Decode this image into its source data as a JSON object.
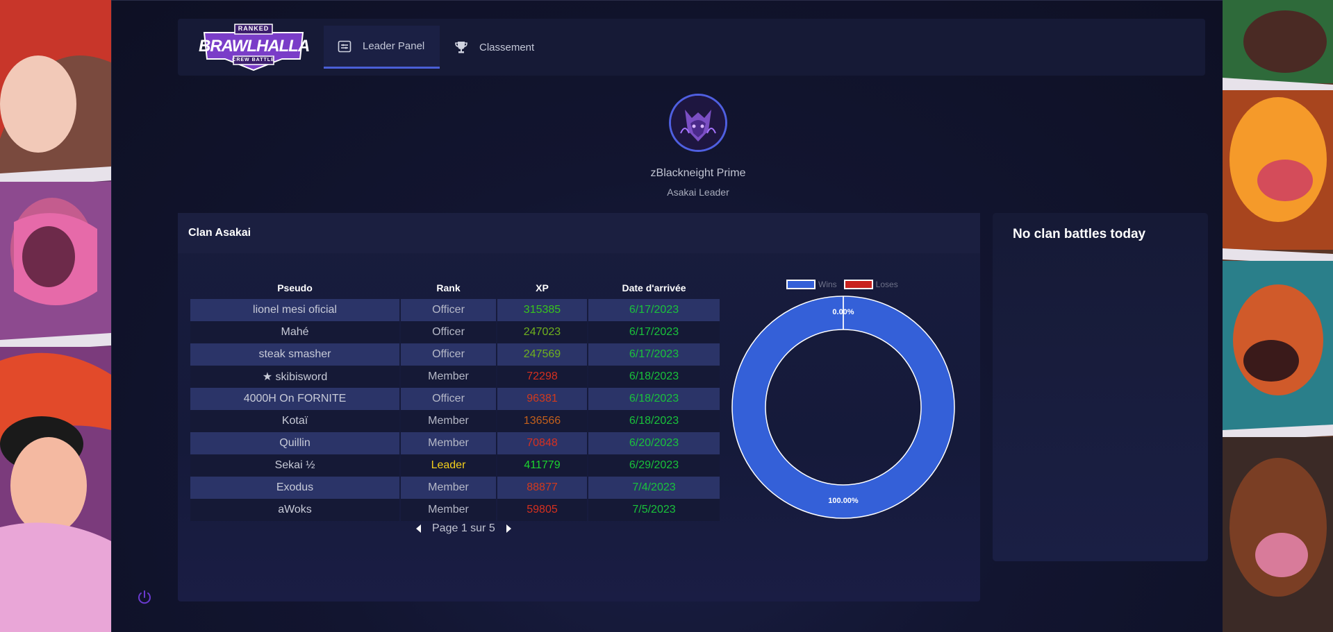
{
  "header": {
    "logo_text": "BRAWLHALLA",
    "logo_top": "RANKED",
    "logo_bottom": "CREW BATTLE",
    "tabs": [
      {
        "label": "Leader Panel",
        "icon": "panel-icon",
        "active": true
      },
      {
        "label": "Classement",
        "icon": "trophy-icon",
        "active": false
      }
    ]
  },
  "profile": {
    "name": "zBlackneight Prime",
    "subtitle": "Asakai Leader"
  },
  "clan": {
    "title": "Clan Asakai",
    "columns": [
      "Pseudo",
      "Rank",
      "XP",
      "Date d'arrivée"
    ],
    "rows": [
      {
        "pseudo": "lionel mesi oficial",
        "rank": "Officer",
        "xp": "315385",
        "xp_color": "#38c41c",
        "date": "6/17/2023"
      },
      {
        "pseudo": "Mahé",
        "rank": "Officer",
        "xp": "247023",
        "xp_color": "#6fb01e",
        "date": "6/17/2023"
      },
      {
        "pseudo": "steak smasher",
        "rank": "Officer",
        "xp": "247569",
        "xp_color": "#6fb01e",
        "date": "6/17/2023"
      },
      {
        "pseudo": "★ skibisword",
        "rank": "Member",
        "xp": "72298",
        "xp_color": "#d6301f",
        "date": "6/18/2023"
      },
      {
        "pseudo": "4000H On FORNITE",
        "rank": "Officer",
        "xp": "96381",
        "xp_color": "#d23a1c",
        "date": "6/18/2023"
      },
      {
        "pseudo": "Kotaï",
        "rank": "Member",
        "xp": "136566",
        "xp_color": "#c3601c",
        "date": "6/18/2023"
      },
      {
        "pseudo": "Quillin",
        "rank": "Member",
        "xp": "70848",
        "xp_color": "#d6301f",
        "date": "6/20/2023"
      },
      {
        "pseudo": "Sekai ½",
        "rank": "Leader",
        "xp": "411779",
        "xp_color": "#1cd42e",
        "date": "6/29/2023"
      },
      {
        "pseudo": "Exodus",
        "rank": "Member",
        "xp": "88877",
        "xp_color": "#d23a1c",
        "date": "7/4/2023"
      },
      {
        "pseudo": "aWoks",
        "rank": "Member",
        "xp": "59805",
        "xp_color": "#d6301f",
        "date": "7/5/2023"
      }
    ],
    "pager_text": "Page 1 sur 5"
  },
  "chart_data": {
    "type": "pie",
    "categories": [
      "Wins",
      "Loses"
    ],
    "values": [
      100.0,
      0.0
    ],
    "value_labels": [
      "100.00%",
      "0.00%"
    ],
    "colors": [
      "#3460d8",
      "#c8231f"
    ],
    "legend_position": "top",
    "title": ""
  },
  "battles": {
    "title": "No clan battles today"
  }
}
